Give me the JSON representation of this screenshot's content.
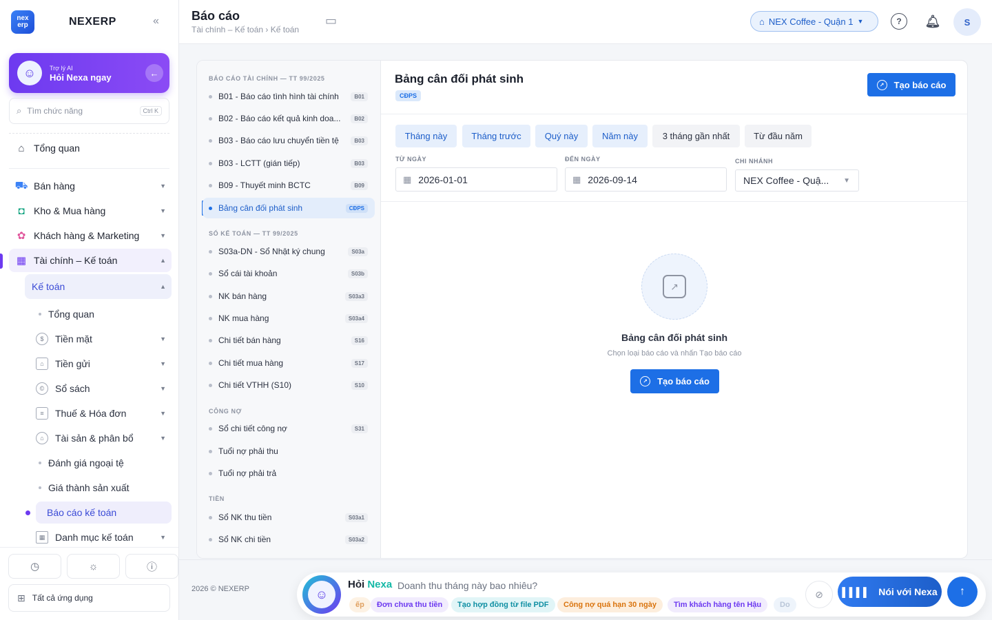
{
  "brand": {
    "logo_text_top": "nex",
    "logo_text_bottom": "erp",
    "name": "NEXERP",
    "collapse": "«"
  },
  "ai_card": {
    "subtitle": "Trợ lý AI",
    "title": "Hỏi Nexa ngay",
    "avatar": "☺",
    "go": "←"
  },
  "search": {
    "placeholder": "Tìm chức năng",
    "shortcut": "Ctrl K",
    "icon": "⌕"
  },
  "nav": {
    "overview": "Tổng quan",
    "sales": "Bán hàng",
    "warehouse": "Kho & Mua hàng",
    "crm": "Khách hàng & Marketing",
    "finance": "Tài chính – Kế toán",
    "accounting": "Kế toán",
    "leaves": {
      "overview": "Tổng quan",
      "cash": "Tiền mặt",
      "deposit": "Tiền gửi",
      "books": "Sổ sách",
      "tax": "Thuế & Hóa đơn",
      "assets": "Tài sản & phân bổ",
      "fx": "Đánh giá ngoại tệ",
      "cost": "Giá thành sản xuất",
      "reports": "Báo cáo kế toán",
      "catalog": "Danh mục kế toán"
    },
    "all_apps": "Tất cả ứng dụng"
  },
  "header": {
    "title": "Báo cáo",
    "breadcrumb": "Tài chính – Kế toán › Kế toán",
    "branch": "NEX Coffee - Quận 1",
    "avatar": "S"
  },
  "reports": {
    "section1": "BÁO CÁO TÀI CHÍNH — TT 99/2025",
    "section2": "SỔ KẾ TOÁN — TT 99/2025",
    "section3": "CÔNG NỢ",
    "section4": "TIỀN",
    "items1": [
      {
        "label": "B01 - Báo cáo tình hình tài chính",
        "code": "B01"
      },
      {
        "label": "B02 - Báo cáo kết quả kinh doa...",
        "code": "B02"
      },
      {
        "label": "B03 - Báo cáo lưu chuyển tiền tệ",
        "code": "B03"
      },
      {
        "label": "B03 - LCTT (gián tiếp)",
        "code": "B03"
      },
      {
        "label": "B09 - Thuyết minh BCTC",
        "code": "B09"
      },
      {
        "label": "Bảng cân đối phát sinh",
        "code": "CĐPS"
      }
    ],
    "items2": [
      {
        "label": "S03a-DN - Sổ Nhật ký chung",
        "code": "S03a"
      },
      {
        "label": "Sổ cái tài khoản",
        "code": "S03b"
      },
      {
        "label": "NK bán hàng",
        "code": "S03a3"
      },
      {
        "label": "NK mua hàng",
        "code": "S03a4"
      },
      {
        "label": "Chi tiết bán hàng",
        "code": "S16"
      },
      {
        "label": "Chi tiết mua hàng",
        "code": "S17"
      },
      {
        "label": "Chi tiết VTHH (S10)",
        "code": "S10"
      }
    ],
    "items3": [
      {
        "label": "Sổ chi tiết công nợ",
        "code": "S31"
      },
      {
        "label": "Tuổi nợ phải thu",
        "code": ""
      },
      {
        "label": "Tuổi nợ phải trả",
        "code": ""
      }
    ],
    "items4": [
      {
        "label": "Sổ NK thu tiền",
        "code": "S03a1"
      },
      {
        "label": "Sổ NK chi tiền",
        "code": "S03a2"
      }
    ]
  },
  "detail": {
    "title": "Bảng cân đối phát sinh",
    "badge": "CĐPS",
    "create": "Tạo báo cáo",
    "chips": [
      "Tháng này",
      "Tháng trước",
      "Quý này",
      "Năm này",
      "3 tháng gần nhất",
      "Từ đầu năm"
    ],
    "from_label": "TỪ NGÀY",
    "from_value": "2026-01-01",
    "to_label": "ĐẾN NGÀY",
    "to_value": "2026-09-14",
    "branch_label": "CHI NHÁNH",
    "branch_value": "NEX Coffee - Quậ...",
    "empty_title": "Bảng cân đối phát sinh",
    "empty_sub": "Chọn loại báo cáo và nhấn Tạo báo cáo",
    "empty_btn": "Tạo báo cáo"
  },
  "footer": {
    "copyright": "2026 © NEXERP",
    "hoi": "Hỏi",
    "nexa": "Nexa",
    "prompt": "Doanh thu tháng này bao nhiêu?",
    "suggestions": [
      {
        "text": "ếp",
        "bg": "#fdf2e4",
        "fg": "#e0a060"
      },
      {
        "text": "Đơn chưa thu tiền",
        "bg": "#f1ecfd",
        "fg": "#6d3af0"
      },
      {
        "text": "Tạo hợp đồng từ file PDF",
        "bg": "#e1f5f7",
        "fg": "#0f8fa3"
      },
      {
        "text": "Công nợ quá hạn 30 ngày",
        "bg": "#fdeedd",
        "fg": "#d9730d"
      },
      {
        "text": "Tìm khách hàng tên Hậu",
        "bg": "#f1ecfd",
        "fg": "#6d3af0"
      },
      {
        "text": "Do",
        "bg": "#eef4fb",
        "fg": "#b9c6d8"
      }
    ],
    "voice": "Nói với Nexa",
    "send": "↑"
  }
}
